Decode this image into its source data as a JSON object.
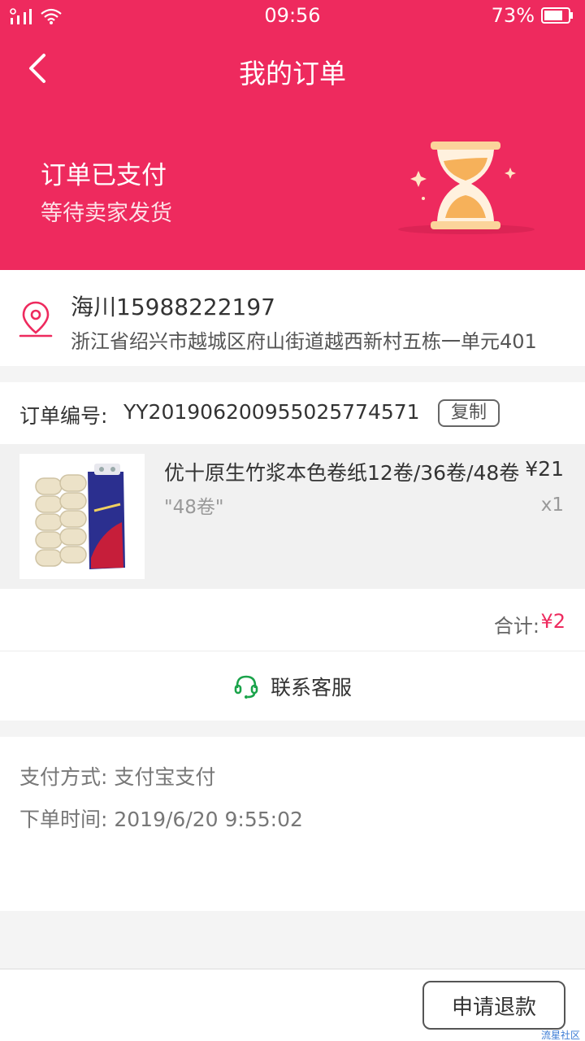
{
  "status_bar": {
    "time": "09:56",
    "battery": "73%",
    "icons": [
      "signal-icon",
      "wifi-icon",
      "battery-icon"
    ]
  },
  "header": {
    "title": "我的订单",
    "back_icon": "chevron-left-icon"
  },
  "banner": {
    "status_title": "订单已支付",
    "status_subtitle": "等待卖家发货",
    "illustration": "hourglass-icon"
  },
  "address": {
    "icon": "location-pin-icon",
    "recipient": "海川15988222197",
    "full_address": "浙江省绍兴市越城区府山街道越西新村五栋一单元401"
  },
  "order": {
    "order_no_label": "订单编号:",
    "order_no": "YY2019062009550257745​71",
    "copy_label": "复制",
    "product": {
      "name": "优十原生竹浆本色卷纸12卷/36卷/48卷",
      "price": "¥21",
      "spec": "\"48卷\"",
      "quantity": "x1"
    },
    "total_label": "合计:",
    "total_value": "¥2",
    "service_label": "联系客服",
    "service_icon": "headset-icon"
  },
  "payment": {
    "method": "支付方式: 支付宝支付",
    "order_time": "下单时间: 2019/6/20 9:55:02"
  },
  "bottom": {
    "refund_label": "申请退款"
  },
  "watermark": "流星社区",
  "colors": {
    "brand": "#ee2a5e",
    "service_green": "#1aa34a",
    "hourglass_gold": "#f6b15a"
  }
}
